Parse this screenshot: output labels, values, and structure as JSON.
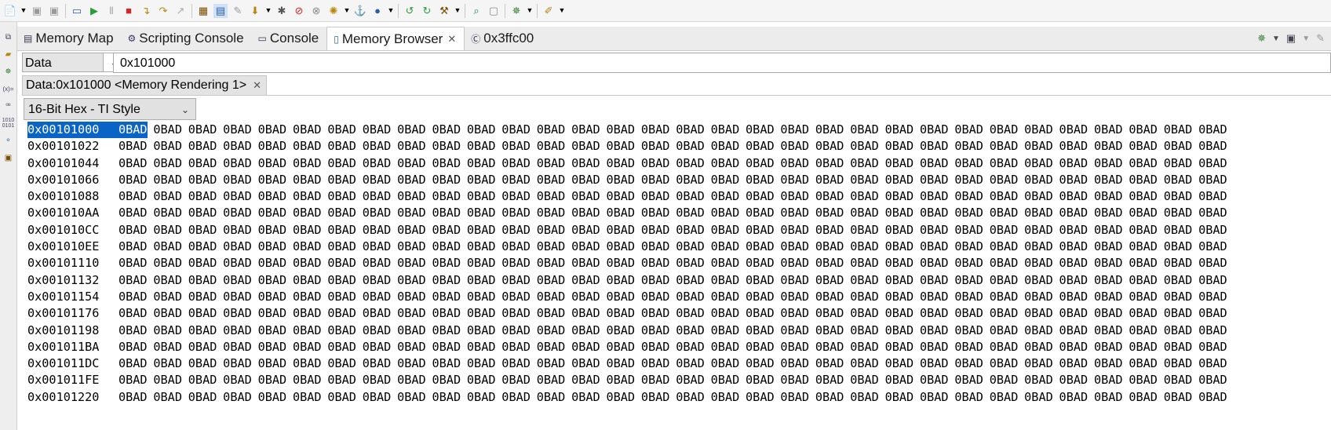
{
  "toolbar": {
    "icons": [
      "new-icon",
      "save-icon",
      "save-all-icon",
      "terminal-icon",
      "resume-icon",
      "suspend-icon",
      "terminate-icon",
      "step-into-icon",
      "step-over-icon",
      "step-return-icon",
      "register-grid-icon",
      "memory-icon",
      "tools-icon",
      "load-program-icon",
      "chip-icon",
      "breakpoint-icon",
      "watch-icon",
      "cpu-reset-icon",
      "restart-icon",
      "connect-icon",
      "refresh-icon",
      "build-icon",
      "search-icon",
      "console-icon",
      "debug-icon",
      "edit-icon"
    ]
  },
  "tabs": [
    {
      "label": "Memory Map",
      "icon": "map-icon"
    },
    {
      "label": "Scripting Console",
      "icon": "script-icon"
    },
    {
      "label": "Console",
      "icon": "console-icon"
    },
    {
      "label": "Memory Browser",
      "icon": "memory-icon",
      "active": true
    },
    {
      "label": "0x3ffc00",
      "icon": "c-file-icon"
    }
  ],
  "memory_space": "Data",
  "address_value": "0x101000",
  "rendering_tab": "Data:0x101000 <Memory Rendering 1>",
  "format": "16-Bit Hex - TI Style",
  "memory": {
    "value_word": "0BAD",
    "words_per_row": 32,
    "rows": [
      {
        "addr": "0x00101000"
      },
      {
        "addr": "0x00101022"
      },
      {
        "addr": "0x00101044"
      },
      {
        "addr": "0x00101066"
      },
      {
        "addr": "0x00101088"
      },
      {
        "addr": "0x001010AA"
      },
      {
        "addr": "0x001010CC"
      },
      {
        "addr": "0x001010EE"
      },
      {
        "addr": "0x00101110"
      },
      {
        "addr": "0x00101132"
      },
      {
        "addr": "0x00101154"
      },
      {
        "addr": "0x00101176"
      },
      {
        "addr": "0x00101198"
      },
      {
        "addr": "0x001011BA"
      },
      {
        "addr": "0x001011DC"
      },
      {
        "addr": "0x001011FE"
      },
      {
        "addr": "0x00101220"
      }
    ]
  },
  "colors": {
    "selection": "#0a64c8",
    "tab_active_bg": "#ffffff"
  }
}
